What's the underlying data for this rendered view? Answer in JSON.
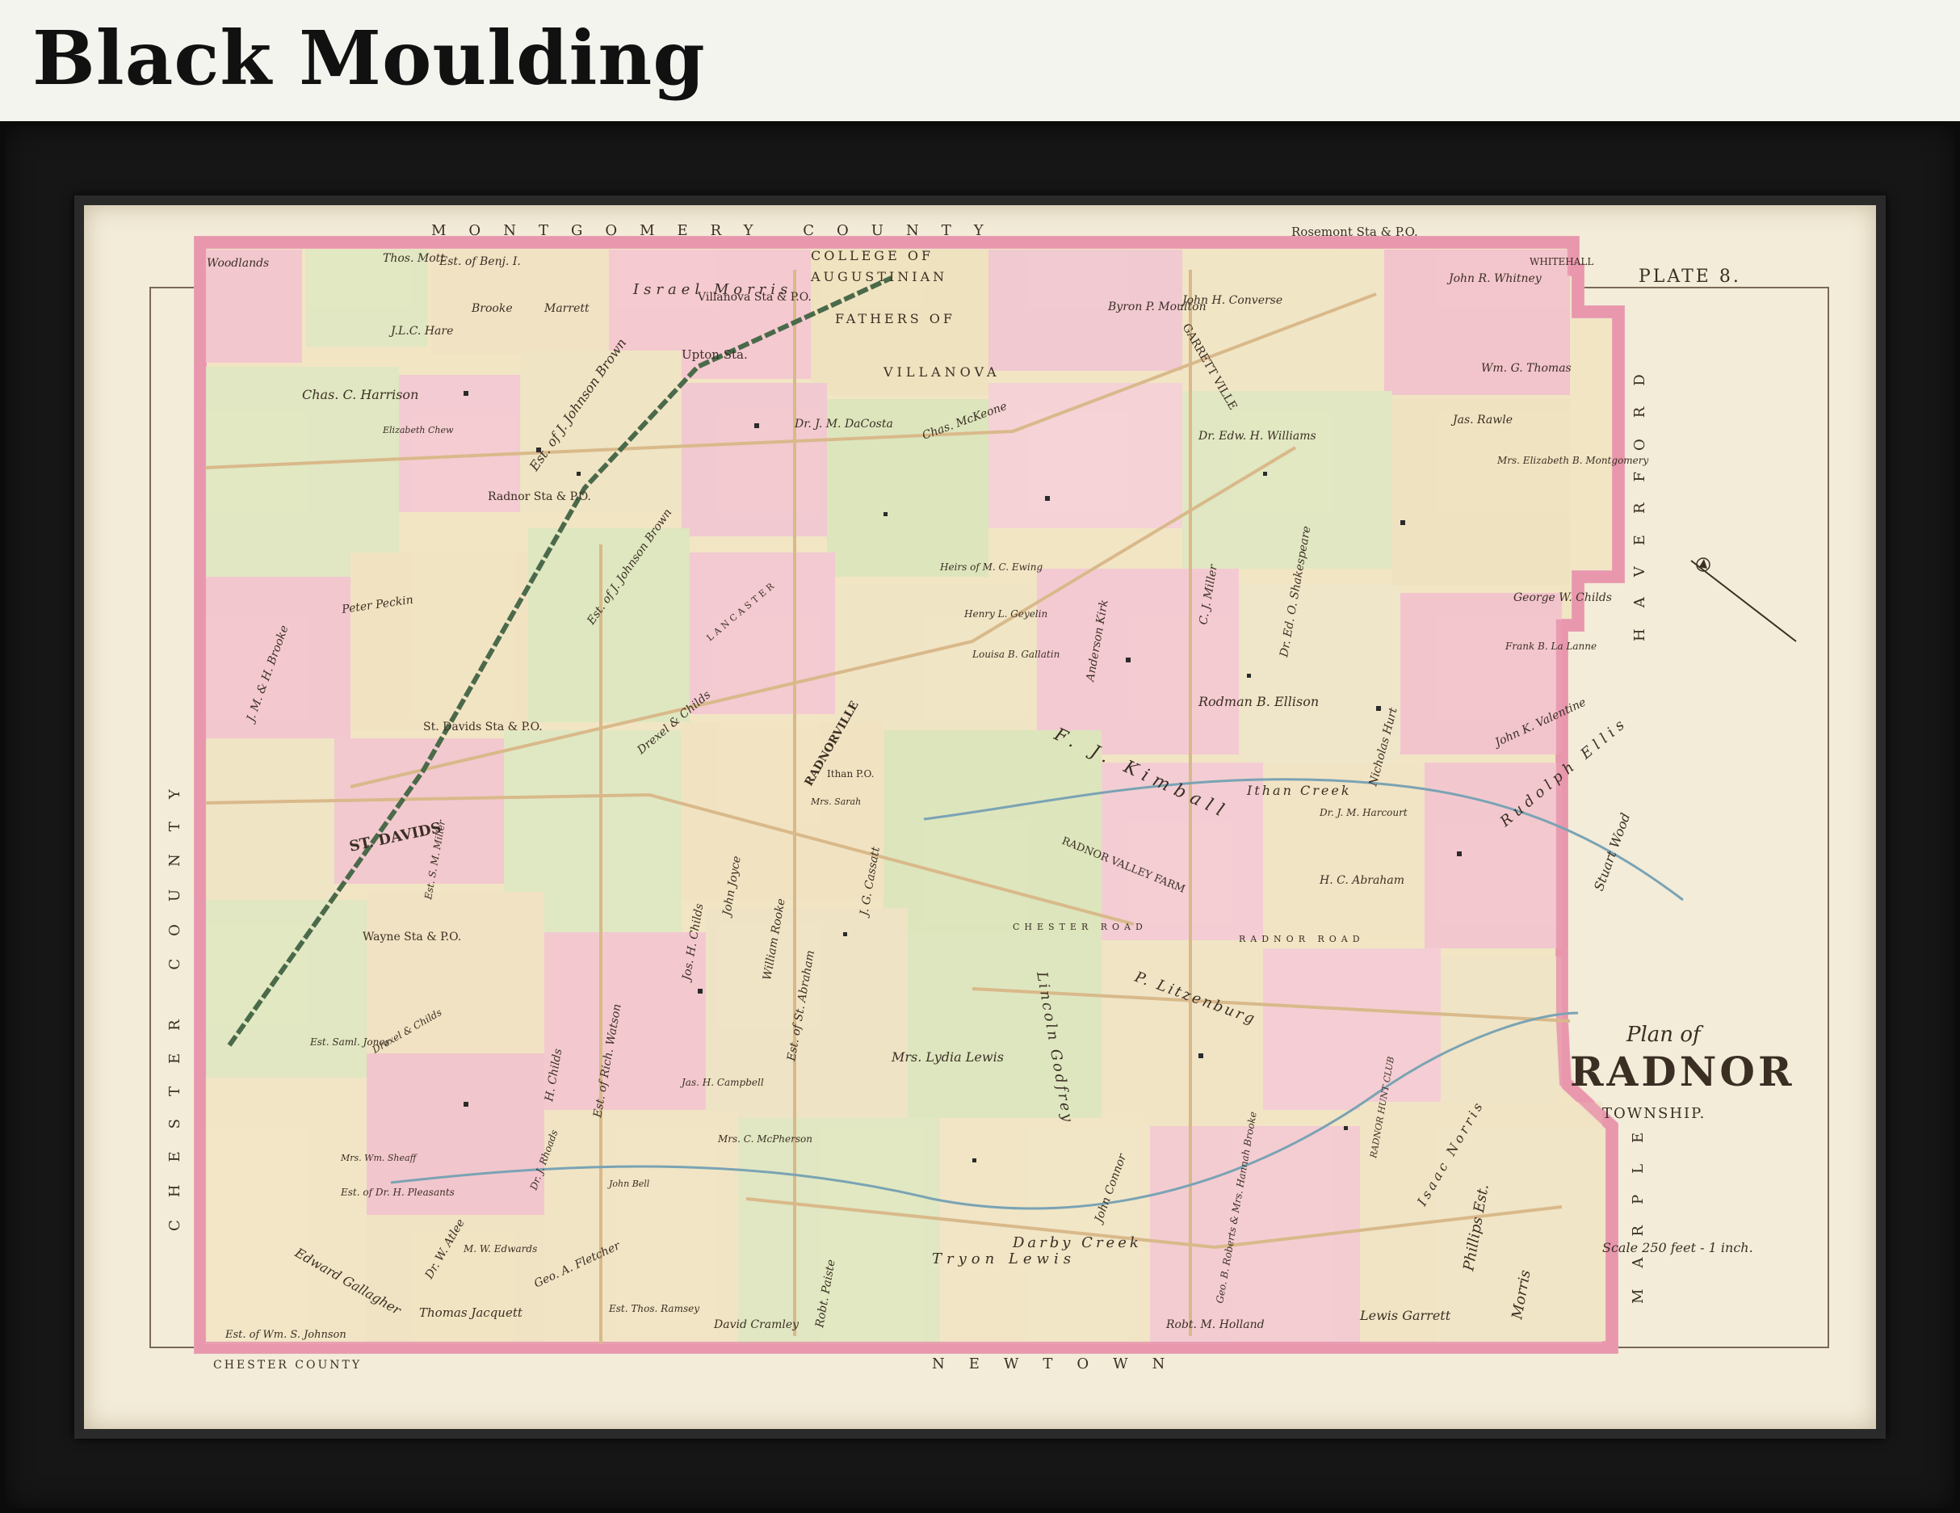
{
  "banner": {
    "title": "Black Moulding"
  },
  "map": {
    "plate": "PLATE 8.",
    "title_line1": "Plan of",
    "title_line2": "RADNOR",
    "title_line3": "TOWNSHIP.",
    "scale": "Scale 250 feet - 1 inch.",
    "borders": {
      "top": "MONTGOMERY COUNTY",
      "left": "CHESTER COUNTY",
      "bottom_left": "CHESTER COUNTY",
      "bottom": "NEWTOWN",
      "right": "MARPLE",
      "right2": "HAVERFORD"
    },
    "places": [
      {
        "text": "Rosemont Sta & P.O."
      },
      {
        "text": "WHITEHALL"
      },
      {
        "text": "COLLEGE OF"
      },
      {
        "text": "AUGUSTINIAN"
      },
      {
        "text": "FATHERS OF"
      },
      {
        "text": "VILLANOVA"
      },
      {
        "text": "Villanova Sta & P.O."
      },
      {
        "text": "Upton Sta."
      },
      {
        "text": "GARRETT VILLE"
      },
      {
        "text": "Radnor Sta & P.O."
      },
      {
        "text": "St. Davids Sta & P.O."
      },
      {
        "text": "ST. DAVIDS"
      },
      {
        "text": "Wayne Sta & P.O."
      },
      {
        "text": "RADNORVILLE"
      },
      {
        "text": "Ithan P.O."
      },
      {
        "text": "RADNOR VALLEY FARM"
      }
    ],
    "owners": [
      {
        "text": "Woodlands"
      },
      {
        "text": "Thos. Mott"
      },
      {
        "text": "Est. of Benj. I."
      },
      {
        "text": "Brooke"
      },
      {
        "text": "Marrett"
      },
      {
        "text": "J.L.C. Hare"
      },
      {
        "text": "Chas. C. Harrison"
      },
      {
        "text": "Israel Morris"
      },
      {
        "text": "Elizabeth Chew"
      },
      {
        "text": "Est. of J. Johnson Brown"
      },
      {
        "text": "Dr. J. M. DaCosta"
      },
      {
        "text": "Chas. McKeone"
      },
      {
        "text": "John H. Converse"
      },
      {
        "text": "Byron P. Moulton"
      },
      {
        "text": "John R. Whitney"
      },
      {
        "text": "Wm. G. Thomas"
      },
      {
        "text": "Jas. Rawle"
      },
      {
        "text": "Mrs. Elizabeth B. Montgomery"
      },
      {
        "text": "Dr. Edw. H. Williams"
      },
      {
        "text": "J. M. & H. Brooke"
      },
      {
        "text": "Peter Peckin"
      },
      {
        "text": "Heirs of M. C. Ewing"
      },
      {
        "text": "Henry L. Geyelin"
      },
      {
        "text": "Louisa B. Gallatin"
      },
      {
        "text": "Anderson Kirk"
      },
      {
        "text": "C. J. Miller"
      },
      {
        "text": "Dr. Ed. O. Shakespeare"
      },
      {
        "text": "George W. Childs"
      },
      {
        "text": "Frank B. La Lanne"
      },
      {
        "text": "Rodman B. Ellison"
      },
      {
        "text": "Nicholas Hurt"
      },
      {
        "text": "John K. Valentine"
      },
      {
        "text": "Drexel & Childs"
      },
      {
        "text": "Est. of J. Johnson Brown"
      },
      {
        "text": "Mrs. Sarah"
      },
      {
        "text": "F. J. Kimball"
      },
      {
        "text": "Rudolph Ellis"
      },
      {
        "text": "Stuart Wood"
      },
      {
        "text": "Dr. J. M. Harcourt"
      },
      {
        "text": "H. C. Abraham"
      },
      {
        "text": "Jos. H. Childs"
      },
      {
        "text": "John Joyce"
      },
      {
        "text": "William Rooke"
      },
      {
        "text": "J. G. Cassatt"
      },
      {
        "text": "P. Litzenburg"
      },
      {
        "text": "Lincoln Godfrey"
      },
      {
        "text": "Mrs. Lydia Lewis"
      },
      {
        "text": "Est. of St. Abraham"
      },
      {
        "text": "Jas. H. Campbell"
      },
      {
        "text": "Mrs. C. McPherson"
      },
      {
        "text": "John Bell"
      },
      {
        "text": "Est. of Rich. Watson"
      },
      {
        "text": "Est. S. M. Miller"
      },
      {
        "text": "H. Childs"
      },
      {
        "text": "Dr. J. Rhoads"
      },
      {
        "text": "Est. Saml. Jones"
      },
      {
        "text": "Drexel & Childs"
      },
      {
        "text": "Mrs. Wm. Sheaff"
      },
      {
        "text": "Est. of Dr. H. Pleasants"
      },
      {
        "text": "Dr. W. Atlee"
      },
      {
        "text": "Edward Gallagher"
      },
      {
        "text": "M. W. Edwards"
      },
      {
        "text": "Geo. A. Fletcher"
      },
      {
        "text": "Est. of Wm. S. Johnson"
      },
      {
        "text": "Thomas Jacquett"
      },
      {
        "text": "Est. Thos. Ramsey"
      },
      {
        "text": "David Cramley"
      },
      {
        "text": "Robt. Paiste"
      },
      {
        "text": "Tryon Lewis"
      },
      {
        "text": "John Connor"
      },
      {
        "text": "Geo. B. Roberts & Mrs. Hannah Brooke"
      },
      {
        "text": "RADNOR HUNT CLUB"
      },
      {
        "text": "Isaac Norris"
      },
      {
        "text": "Robt. M. Holland"
      },
      {
        "text": "Lewis Garrett"
      },
      {
        "text": "Morris"
      },
      {
        "text": "Phillips Est."
      }
    ],
    "creeks": [
      {
        "text": "Ithan Creek"
      },
      {
        "text": "Darby Creek"
      }
    ],
    "roads": [
      {
        "text": "CHESTER ROAD"
      },
      {
        "text": "RADNOR ROAD"
      },
      {
        "text": "LANCASTER"
      }
    ]
  }
}
